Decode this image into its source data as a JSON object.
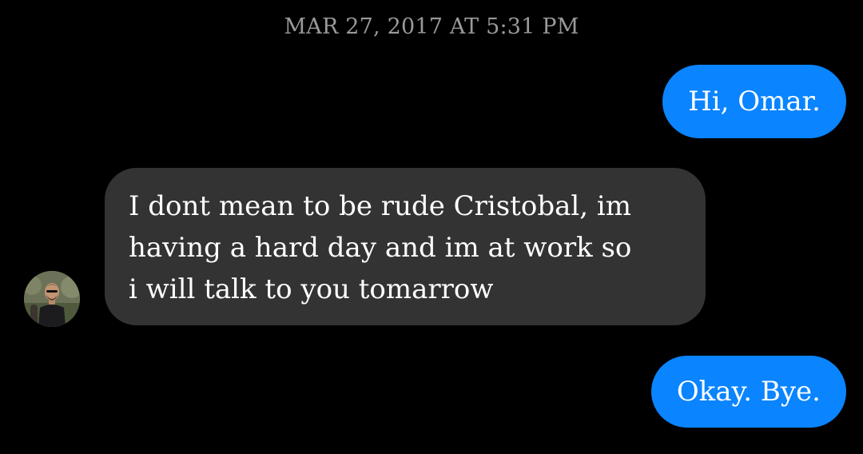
{
  "thread": {
    "timestamp": "MAR 27, 2017 AT 5:31 PM",
    "messages": [
      {
        "direction": "outgoing",
        "text": "Hi, Omar."
      },
      {
        "direction": "incoming",
        "text": "I dont mean to be rude Cristobal, im\nhaving a hard day and im at work so\ni will talk to you tomarrow"
      },
      {
        "direction": "outgoing",
        "text": "Okay. Bye."
      }
    ]
  },
  "contact": {
    "avatar_icon": "contact-avatar-photo"
  },
  "colors": {
    "background": "#000000",
    "outgoing_bubble": "#0a84ff",
    "incoming_bubble": "#333333",
    "timestamp_text": "#9a9a9a"
  }
}
